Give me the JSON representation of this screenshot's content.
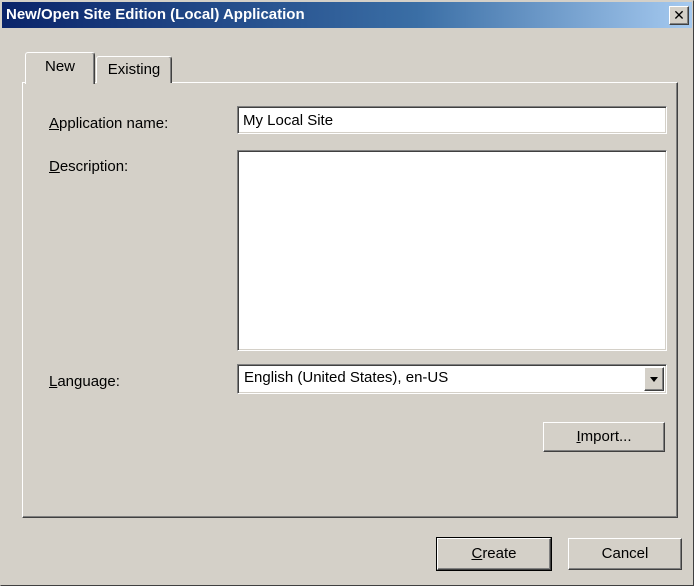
{
  "window": {
    "title": "New/Open Site Edition (Local) Application",
    "close_label": "✕"
  },
  "tabs": [
    {
      "label": "New",
      "active": true
    },
    {
      "label": "Existing",
      "active": false
    }
  ],
  "form": {
    "app_name": {
      "label_mnemonic": "A",
      "label_rest": "pplication name:",
      "value": "My Local Site"
    },
    "description": {
      "label_mnemonic": "D",
      "label_rest": "escription:",
      "value": ""
    },
    "language": {
      "label_mnemonic": "L",
      "label_rest": "anguage:",
      "selected": "English (United States), en-US"
    }
  },
  "buttons": {
    "import": {
      "mnemonic": "I",
      "rest": "mport..."
    },
    "create": {
      "mnemonic": "C",
      "rest": "reate"
    },
    "cancel": {
      "label": "Cancel"
    }
  }
}
